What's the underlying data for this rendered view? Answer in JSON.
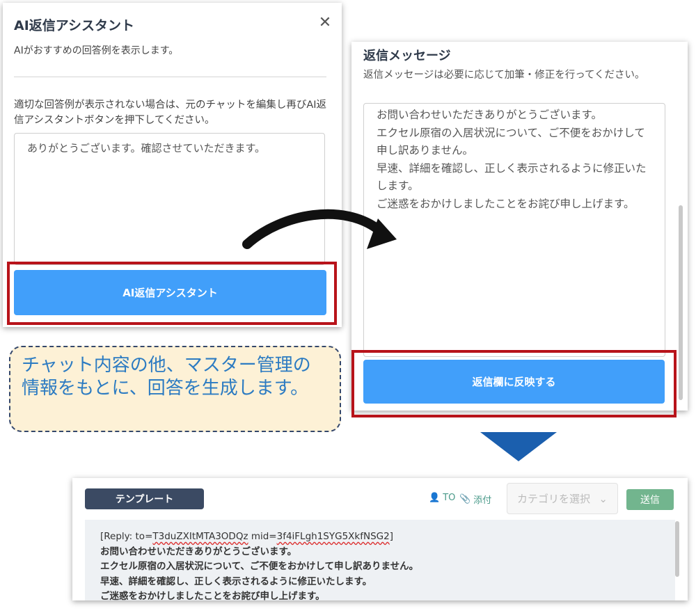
{
  "assistant_panel": {
    "title": "AI返信アシスタント",
    "subtitle": "AIがおすすめの回答例を表示します。",
    "note": "適切な回答例が表示されない場合は、元のチャットを編集し再びAI返信アシスタントボタンを押下してください。",
    "suggestion_text": "ありがとうございます。確認させていただきます。",
    "button_label": "AI返信アシスタント",
    "close_icon": "close-icon"
  },
  "reply_panel": {
    "title": "返信メッセージ",
    "subtitle": "返信メッセージは必要に応じて加筆・修正を行ってください。",
    "message_lines": [
      "お問い合わせいただきありがとうございます。",
      "エクセル原宿の入居状況について、ご不便をおかけして申し訳ありません。",
      "早速、詳細を確認し、正しく表示されるように修正いたします。",
      "ご迷惑をおかけしましたことをお詫び申し上げます。"
    ],
    "button_label": "返信欄に反映する"
  },
  "callout": {
    "text": "チャット内容の他、マスター管理の情報をもとに、回答を生成します。"
  },
  "chat_box": {
    "template_button": "テンプレート",
    "to_label": "TO",
    "attach_label": "添付",
    "category_placeholder": "カテゴリを選択",
    "send_button": "送信",
    "reply_prefix": "[Reply: to=",
    "reply_to_id": "T3duZXItMTA3ODQz",
    "reply_mid_label": " mid=",
    "reply_mid_id": "3f4iFLgh1SYG5XkfNSG2",
    "reply_suffix": "]",
    "lines": [
      "お問い合わせいただきありがとうございます。",
      "エクセル原宿の入居状況について、ご不便をおかけして申し訳ありません。",
      "早速、詳細を確認し、正しく表示されるように修正いたします。",
      "ご迷惑をおかけしましたことをお詫び申し上げます。"
    ]
  },
  "colors": {
    "highlight_border": "#b8131a",
    "primary_button": "#419ffa",
    "callout_bg": "#fdf1d6",
    "callout_text": "#2c7bc2",
    "template_button": "#3b4a63",
    "send_button": "#72b58e",
    "down_arrow": "#1b5fae"
  }
}
